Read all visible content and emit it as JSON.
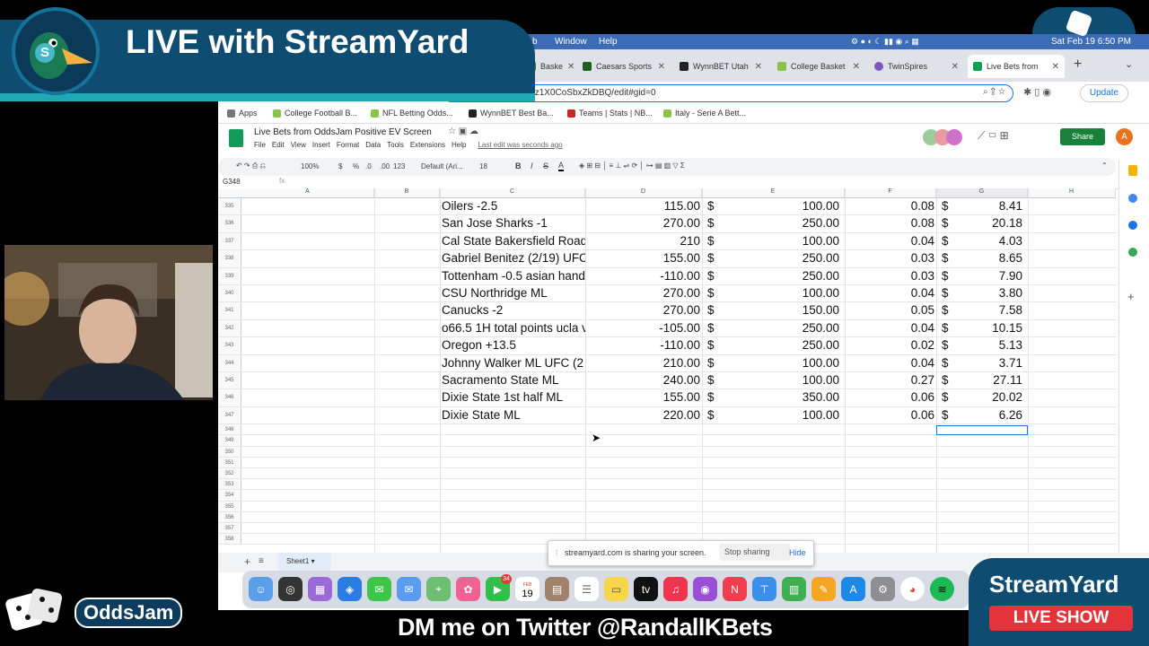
{
  "banner": {
    "title": "LIVE with StreamYard",
    "logo_letter": "S"
  },
  "mac_menu": {
    "items": [
      "b",
      "Window",
      "Help"
    ],
    "clock": "Sat Feb 19  6:50 PM"
  },
  "browser": {
    "tabs": [
      {
        "label": "Baske",
        "color": "#2e7d32"
      },
      {
        "label": "Caesars Sports",
        "color": "#1b5e20"
      },
      {
        "label": "WynnBET Utah",
        "color": "#222222"
      },
      {
        "label": "College Basket",
        "color": "#8bc34a"
      },
      {
        "label": "TwinSpires",
        "color": "#7e57c2"
      },
      {
        "label": "Live Bets from",
        "color": "#0f9d58",
        "active": true
      }
    ],
    "url": "gOxTolpneVciU4YrHz1X0CoSbxZkDBQ/edit#gid=0",
    "update_label": "Update",
    "bookmarks": [
      {
        "label": "Apps",
        "color": "#777777"
      },
      {
        "label": "College Football B...",
        "color": "#8bc34a"
      },
      {
        "label": "NFL Betting Odds...",
        "color": "#8bc34a"
      },
      {
        "label": "WynnBET Best Ba...",
        "color": "#222222"
      },
      {
        "label": "Teams | Stats | NB...",
        "color": "#c62828"
      },
      {
        "label": "Italy - Serie A Bett...",
        "color": "#8bc34a"
      }
    ]
  },
  "sheet": {
    "title": "Live Bets from OddsJam Positive EV Screen",
    "menus": [
      "File",
      "Edit",
      "View",
      "Insert",
      "Format",
      "Data",
      "Tools",
      "Extensions",
      "Help"
    ],
    "last_edit": "Last edit was seconds ago",
    "share_label": "Share",
    "avatar_letter": "A",
    "toolbar": {
      "zoom": "100%",
      "currency": "$",
      "percent": "%",
      "dec1": ".0",
      "dec2": ".00",
      "fmt": "123",
      "font": "Default (Ari...",
      "size": "18",
      "bold": "B",
      "italic": "I",
      "strike": "S",
      "color": "A"
    },
    "cell_ref": "G348",
    "columns": [
      "A",
      "B",
      "C",
      "D",
      "E",
      "F",
      "G",
      "H"
    ],
    "rows": [
      {
        "n": "335",
        "c": "Oilers -2.5",
        "d": "115.00",
        "e_cur": "$",
        "e": "100.00",
        "f": "0.08",
        "g_cur": "$",
        "g": "8.41"
      },
      {
        "n": "336",
        "c": "San Jose Sharks -1",
        "d": "270.00",
        "e_cur": "$",
        "e": "250.00",
        "f": "0.08",
        "g_cur": "$",
        "g": "20.18"
      },
      {
        "n": "337",
        "c": "Cal State Bakersfield Road",
        "d": "210",
        "e_cur": "$",
        "e": "100.00",
        "f": "0.04",
        "g_cur": "$",
        "g": "4.03"
      },
      {
        "n": "338",
        "c": "Gabriel Benitez (2/19) UFC",
        "d": "155.00",
        "e_cur": "$",
        "e": "250.00",
        "f": "0.03",
        "g_cur": "$",
        "g": "8.65"
      },
      {
        "n": "339",
        "c": "Tottenham -0.5 asian hand",
        "d": "-110.00",
        "e_cur": "$",
        "e": "250.00",
        "f": "0.03",
        "g_cur": "$",
        "g": "7.90"
      },
      {
        "n": "340",
        "c": "CSU Northridge ML",
        "d": "270.00",
        "e_cur": "$",
        "e": "100.00",
        "f": "0.04",
        "g_cur": "$",
        "g": "3.80"
      },
      {
        "n": "341",
        "c": "Canucks -2",
        "d": "270.00",
        "e_cur": "$",
        "e": "150.00",
        "f": "0.05",
        "g_cur": "$",
        "g": "7.58"
      },
      {
        "n": "342",
        "c": "o66.5 1H total points ucla v",
        "d": "-105.00",
        "e_cur": "$",
        "e": "250.00",
        "f": "0.04",
        "g_cur": "$",
        "g": "10.15"
      },
      {
        "n": "343",
        "c": "Oregon +13.5",
        "d": "-110.00",
        "e_cur": "$",
        "e": "250.00",
        "f": "0.02",
        "g_cur": "$",
        "g": "5.13"
      },
      {
        "n": "344",
        "c": "Johnny Walker ML UFC (2",
        "d": "210.00",
        "e_cur": "$",
        "e": "100.00",
        "f": "0.04",
        "g_cur": "$",
        "g": "3.71"
      },
      {
        "n": "345",
        "c": "Sacramento State ML",
        "d": "240.00",
        "e_cur": "$",
        "e": "100.00",
        "f": "0.27",
        "g_cur": "$",
        "g": "27.11"
      },
      {
        "n": "346",
        "c": "Dixie State 1st half ML",
        "d": "155.00",
        "e_cur": "$",
        "e": "350.00",
        "f": "0.06",
        "g_cur": "$",
        "g": "20.02"
      },
      {
        "n": "347",
        "c": "Dixie State ML",
        "d": "220.00",
        "e_cur": "$",
        "e": "100.00",
        "f": "0.06",
        "g_cur": "$",
        "g": "6.26"
      }
    ],
    "empty_rows": [
      "348",
      "349",
      "350",
      "351",
      "352",
      "353",
      "354",
      "355",
      "356",
      "357",
      "358"
    ],
    "sheet_tab": "Sheet1"
  },
  "share_notice": {
    "text": "streamyard.com is sharing your screen.",
    "stop": "Stop sharing",
    "hide": "Hide"
  },
  "dock": {
    "calendar_month": "FEB",
    "calendar_day": "19",
    "badge": "34"
  },
  "oddsjam": {
    "label": "OddsJam"
  },
  "streamyard": {
    "title": "StreamYard",
    "subtitle": "LIVE SHOW"
  },
  "footer": {
    "text": "DM me on Twitter @RandallKBets"
  }
}
